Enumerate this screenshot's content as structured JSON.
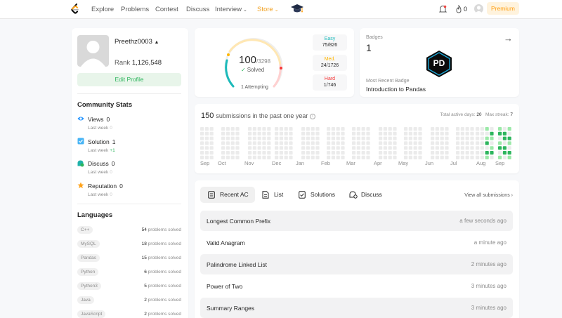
{
  "nav": {
    "items": [
      "Explore",
      "Problems",
      "Contest",
      "Discuss",
      "Interview",
      "Store"
    ],
    "streak": "0",
    "premium_label": "Premium",
    "brand_color": "#ffa116"
  },
  "profile": {
    "username": "Preethz0003",
    "rank_label": "Rank",
    "rank_value": "1,126,548",
    "edit_label": "Edit Profile"
  },
  "community": {
    "title": "Community Stats",
    "stats": [
      {
        "label": "Views",
        "value": "0",
        "sub": "Last week",
        "delta": "0",
        "icon": "eye-icon",
        "color": "#1a90ff"
      },
      {
        "label": "Solution",
        "value": "1",
        "sub": "Last week",
        "delta": "+1",
        "icon": "solution-icon",
        "color": "#47b4f5"
      },
      {
        "label": "Discuss",
        "value": "0",
        "sub": "Last week",
        "delta": "0",
        "icon": "discuss-icon",
        "color": "#20b2aa"
      },
      {
        "label": "Reputation",
        "value": "0",
        "sub": "Last week",
        "delta": "0",
        "icon": "star-icon",
        "color": "#ffa116"
      }
    ]
  },
  "languages": {
    "title": "Languages",
    "suffix": "problems solved",
    "items": [
      {
        "name": "C++",
        "count": "54"
      },
      {
        "name": "MySQL",
        "count": "18"
      },
      {
        "name": "Pandas",
        "count": "15"
      },
      {
        "name": "Python",
        "count": "6"
      },
      {
        "name": "Python3",
        "count": "5"
      },
      {
        "name": "Java",
        "count": "2"
      },
      {
        "name": "JavaScript",
        "count": "2"
      }
    ]
  },
  "progress": {
    "solved": "100",
    "total": "/3298",
    "solved_label": "Solved",
    "attempting": "1 Attempting",
    "difficulties": [
      {
        "name": "Easy",
        "value": "75/826",
        "color": "#1cbaba"
      },
      {
        "name": "Med.",
        "value": "24/1726",
        "color": "#ffb700"
      },
      {
        "name": "Hard",
        "value": "1/746",
        "color": "#f63737"
      }
    ]
  },
  "badges": {
    "label": "Badges",
    "count": "1",
    "badge_text": "PD",
    "recent_label": "Most Recent Badge",
    "recent_name": "Introduction to Pandas"
  },
  "submissions": {
    "count": "150",
    "title": "submissions in the past one year",
    "active_label": "Total active days:",
    "active_days": "20",
    "streak_label": "Max streak:",
    "max_streak": "7",
    "months": [
      "Sep",
      "Oct",
      "Nov",
      "Dec",
      "Jan",
      "Feb",
      "Mar",
      "Apr",
      "May",
      "Jun",
      "Jul",
      "Aug",
      "Sep"
    ]
  },
  "recent": {
    "tabs": [
      "Recent AC",
      "List",
      "Solutions",
      "Discuss"
    ],
    "view_all": "View all submissions",
    "rows": [
      {
        "title": "Longest Common Prefix",
        "time": "a few seconds ago"
      },
      {
        "title": "Valid Anagram",
        "time": "a minute ago"
      },
      {
        "title": "Palindrome Linked List",
        "time": "2 minutes ago"
      },
      {
        "title": "Power of Two",
        "time": "3 minutes ago"
      },
      {
        "title": "Summary Ranges",
        "time": "3 minutes ago"
      }
    ]
  }
}
